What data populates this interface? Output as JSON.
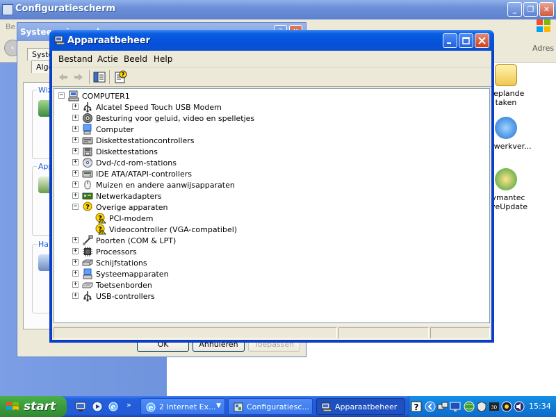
{
  "control_panel": {
    "title": "Configuratiescherm",
    "menu_first": "Be",
    "address_label": "Adres",
    "items": [
      {
        "label_line1": "Geplande",
        "label_line2": "taken"
      },
      {
        "label_line1": "Netwerkver...",
        "label_line2": ""
      },
      {
        "label_line1": "Symantec",
        "label_line2": "LiveUpdate"
      }
    ]
  },
  "system_properties": {
    "title": "Systeemeigenschappen",
    "tabs": [
      "Syste",
      "Alge"
    ],
    "groups": [
      "Wiz",
      "App",
      "Har"
    ],
    "buttons": {
      "ok": "OK",
      "cancel": "Annuleren",
      "apply": "Toepassen"
    }
  },
  "device_manager": {
    "title": "Apparaatbeheer",
    "menu": [
      "Bestand",
      "Actie",
      "Beeld",
      "Help"
    ],
    "tree": {
      "root": "COMPUTER1",
      "nodes": [
        {
          "label": "Alcatel Speed Touch USB Modem",
          "icon": "usb-icon",
          "expanded": false
        },
        {
          "label": "Besturing voor geluid, video en spelletjes",
          "icon": "speaker-icon",
          "expanded": false
        },
        {
          "label": "Computer",
          "icon": "computer-icon",
          "expanded": false
        },
        {
          "label": "Diskettestationcontrollers",
          "icon": "floppy-controller-icon",
          "expanded": false
        },
        {
          "label": "Diskettestations",
          "icon": "floppy-drive-icon",
          "expanded": false
        },
        {
          "label": "Dvd-/cd-rom-stations",
          "icon": "cdrom-icon",
          "expanded": false
        },
        {
          "label": "IDE ATA/ATAPI-controllers",
          "icon": "ide-controller-icon",
          "expanded": false
        },
        {
          "label": "Muizen en andere aanwijsapparaten",
          "icon": "mouse-icon",
          "expanded": false
        },
        {
          "label": "Netwerkadapters",
          "icon": "network-adapter-icon",
          "expanded": false
        },
        {
          "label": "Overige apparaten",
          "icon": "unknown-device-icon",
          "expanded": true,
          "children": [
            {
              "label": "PCI-modem",
              "icon": "warning-device-icon"
            },
            {
              "label": "Videocontroller (VGA-compatibel)",
              "icon": "warning-device-icon"
            }
          ]
        },
        {
          "label": "Poorten (COM & LPT)",
          "icon": "port-icon",
          "expanded": false
        },
        {
          "label": "Processors",
          "icon": "processor-icon",
          "expanded": false
        },
        {
          "label": "Schijfstations",
          "icon": "disk-drive-icon",
          "expanded": false
        },
        {
          "label": "Systeemapparaten",
          "icon": "system-device-icon",
          "expanded": false
        },
        {
          "label": "Toetsenborden",
          "icon": "keyboard-icon",
          "expanded": false
        },
        {
          "label": "USB-controllers",
          "icon": "usb-icon",
          "expanded": false
        }
      ]
    }
  },
  "taskbar": {
    "start_label": "start",
    "tasks": [
      {
        "label": "2 Internet Ex...",
        "icon": "ie-icon",
        "active": false,
        "grouped": true
      },
      {
        "label": "Configuratiesc...",
        "icon": "control-panel-icon",
        "active": false
      },
      {
        "label": "Apparaatbeheer",
        "icon": "device-manager-icon",
        "active": true
      }
    ],
    "clock": "15:34"
  },
  "colors": {
    "xp_blue": "#0a5de0",
    "start_green": "#3c9a3c",
    "tray_blue": "#0f7bd8",
    "group_label_blue": "#1d5bd6",
    "warning_yellow": "#ffd800"
  }
}
